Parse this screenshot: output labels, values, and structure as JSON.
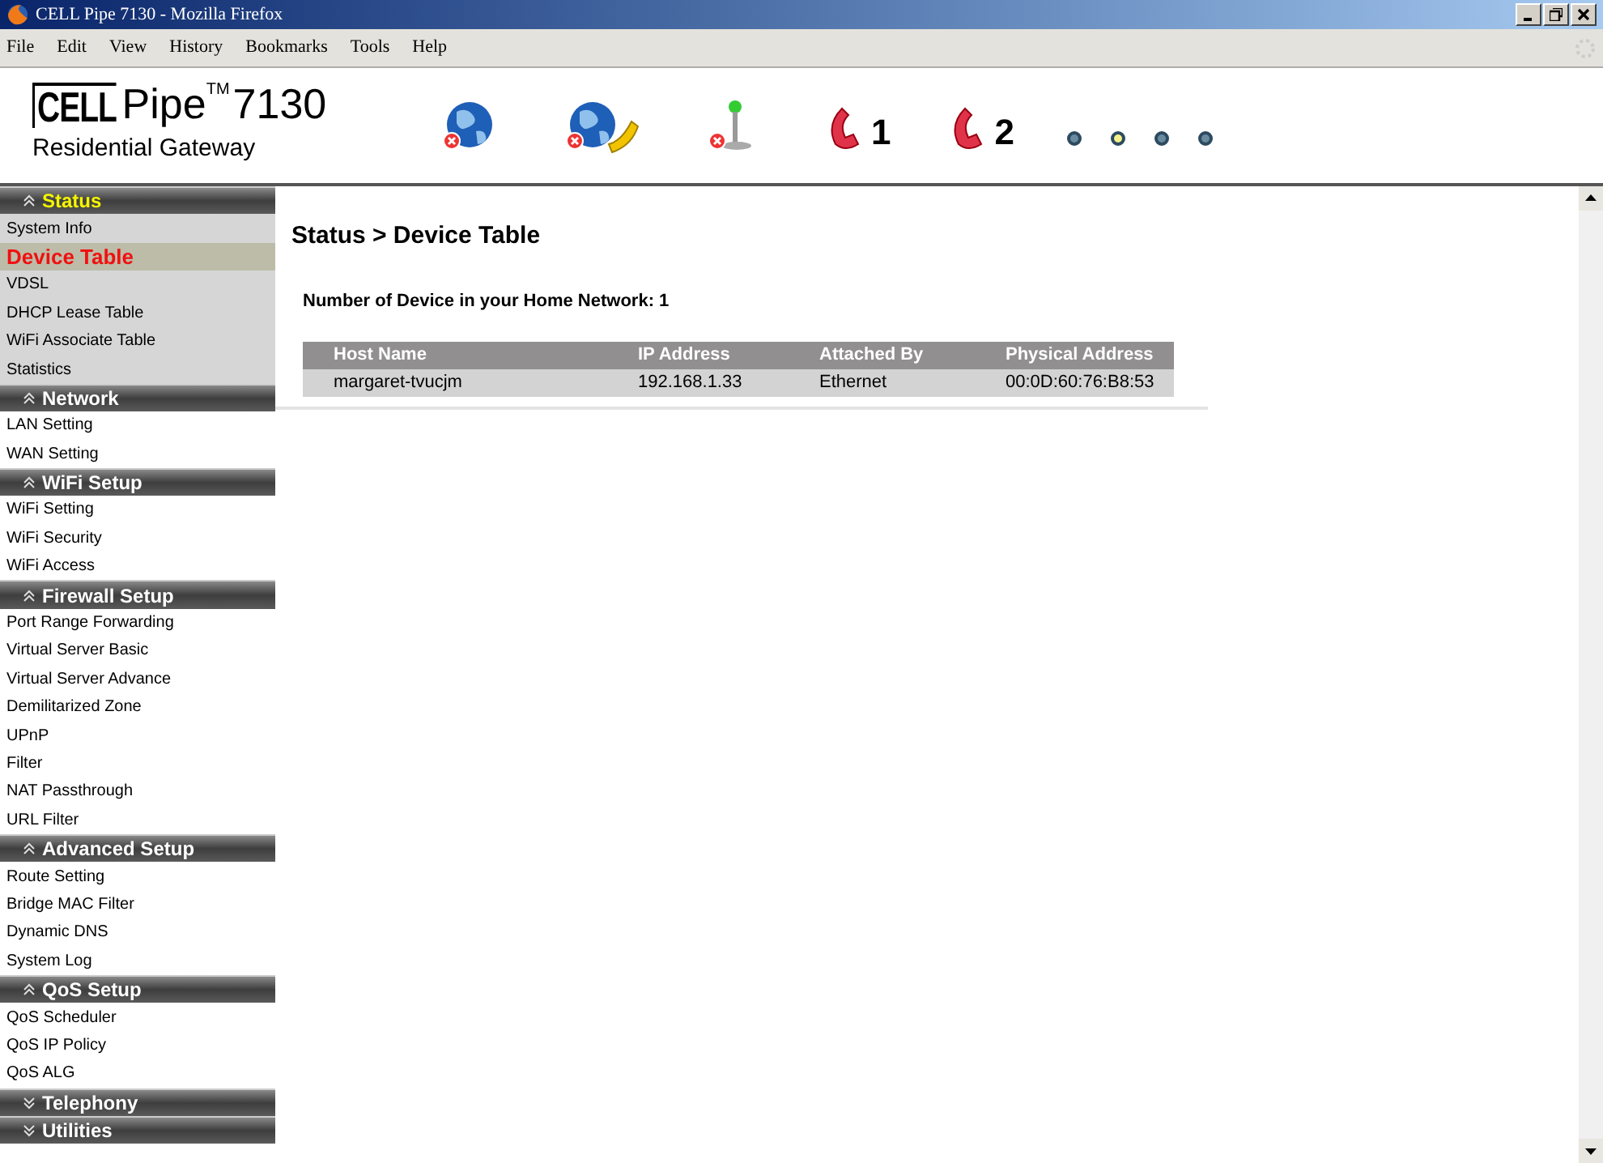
{
  "window": {
    "title": "CELL Pipe 7130 - Mozilla Firefox"
  },
  "menu": [
    "File",
    "Edit",
    "View",
    "History",
    "Bookmarks",
    "Tools",
    "Help"
  ],
  "logo": {
    "boxed": "CELL",
    "name": "Pipe",
    "mark": "TM",
    "model": "7130",
    "subtitle": "Residential Gateway"
  },
  "status_icons": [
    {
      "kind": "globe",
      "error": true
    },
    {
      "kind": "globe-phone",
      "error": true
    },
    {
      "kind": "antenna",
      "error": true
    },
    {
      "kind": "phone",
      "label": "1"
    },
    {
      "kind": "phone",
      "label": "2"
    }
  ],
  "leds": [
    {
      "on": false
    },
    {
      "on": true
    },
    {
      "on": false
    },
    {
      "on": false
    }
  ],
  "sidebar": [
    {
      "title": "Status",
      "expanded": true,
      "active": true,
      "items": [
        {
          "label": "System Info",
          "selected": false
        },
        {
          "label": "Device Table",
          "selected": true
        },
        {
          "label": "VDSL",
          "selected": false
        },
        {
          "label": "DHCP Lease Table",
          "selected": false
        },
        {
          "label": "WiFi Associate Table",
          "selected": false
        },
        {
          "label": "Statistics",
          "selected": false
        }
      ]
    },
    {
      "title": "Network",
      "expanded": true,
      "active": false,
      "items": [
        {
          "label": "LAN Setting",
          "selected": false
        },
        {
          "label": "WAN Setting",
          "selected": false
        }
      ]
    },
    {
      "title": "WiFi Setup",
      "expanded": true,
      "active": false,
      "items": [
        {
          "label": "WiFi Setting",
          "selected": false
        },
        {
          "label": "WiFi Security",
          "selected": false
        },
        {
          "label": "WiFi Access",
          "selected": false
        }
      ]
    },
    {
      "title": "Firewall Setup",
      "expanded": true,
      "active": false,
      "items": [
        {
          "label": "Port Range Forwarding",
          "selected": false
        },
        {
          "label": "Virtual Server Basic",
          "selected": false
        },
        {
          "label": "Virtual Server Advance",
          "selected": false
        },
        {
          "label": "Demilitarized Zone",
          "selected": false
        },
        {
          "label": "UPnP",
          "selected": false
        },
        {
          "label": "Filter",
          "selected": false
        },
        {
          "label": "NAT Passthrough",
          "selected": false
        },
        {
          "label": "URL Filter",
          "selected": false
        }
      ]
    },
    {
      "title": "Advanced Setup",
      "expanded": true,
      "active": false,
      "items": [
        {
          "label": "Route Setting",
          "selected": false
        },
        {
          "label": "Bridge MAC Filter",
          "selected": false
        },
        {
          "label": "Dynamic DNS",
          "selected": false
        },
        {
          "label": "System Log",
          "selected": false
        }
      ]
    },
    {
      "title": "QoS Setup",
      "expanded": true,
      "active": false,
      "items": [
        {
          "label": "QoS Scheduler",
          "selected": false
        },
        {
          "label": "QoS IP Policy",
          "selected": false
        },
        {
          "label": "QoS ALG",
          "selected": false
        }
      ]
    },
    {
      "title": "Telephony",
      "expanded": false,
      "active": false
    },
    {
      "title": "Utilities",
      "expanded": false,
      "active": false
    }
  ],
  "content": {
    "breadcrumb": "Status > Device Table",
    "summary": "Number of Device in your Home Network: 1",
    "table": {
      "columns": [
        "Host Name",
        "IP Address",
        "Attached By",
        "Physical Address"
      ],
      "rows": [
        [
          "margaret-tvucjm",
          "192.168.1.33",
          "Ethernet",
          "00:0D:60:76:B8:53"
        ]
      ]
    }
  }
}
